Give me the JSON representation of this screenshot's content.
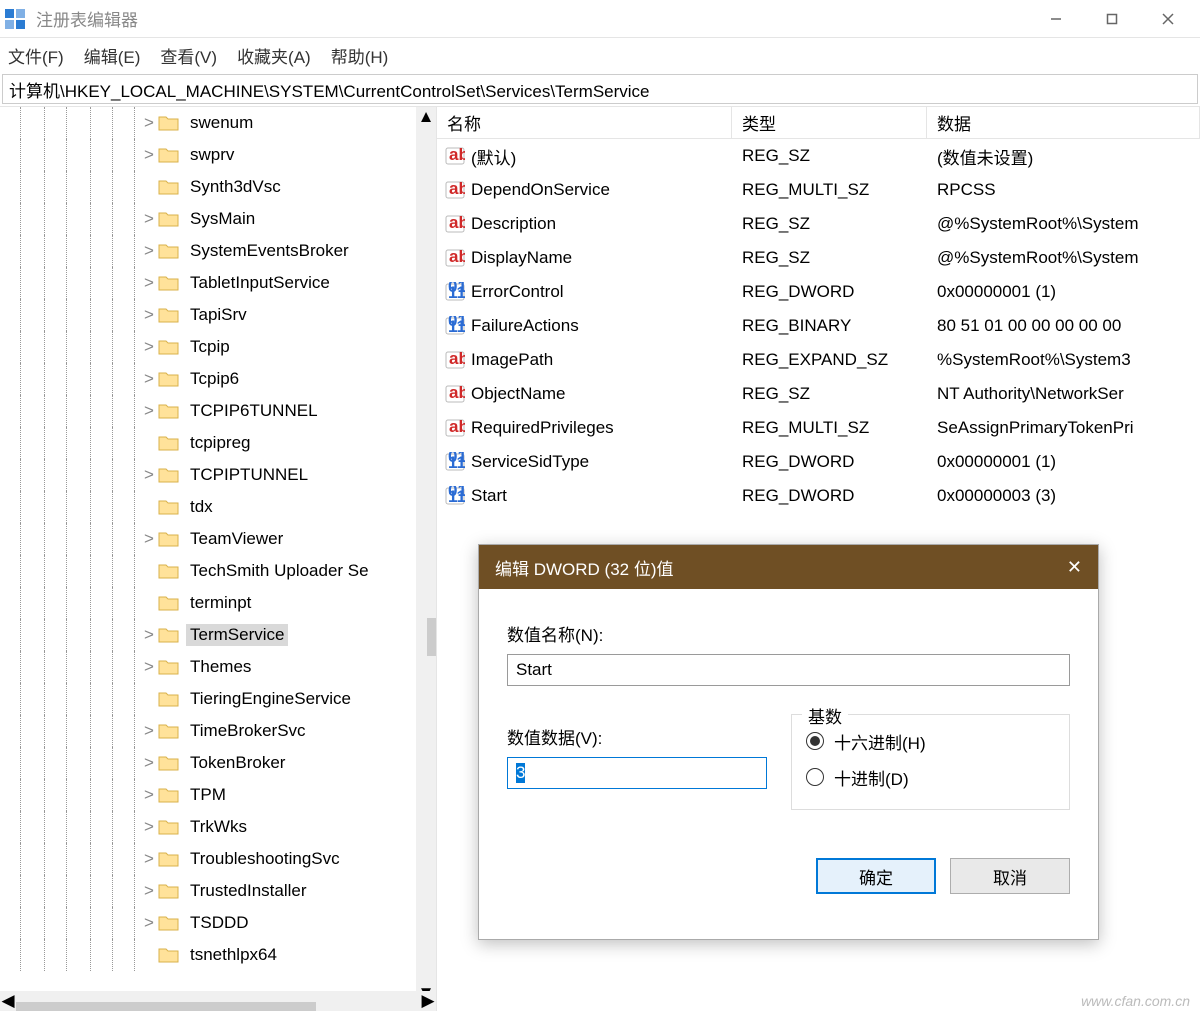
{
  "window": {
    "title": "注册表编辑器"
  },
  "menubar": {
    "file": "文件(F)",
    "edit": "编辑(E)",
    "view": "查看(V)",
    "favorites": "收藏夹(A)",
    "help": "帮助(H)"
  },
  "address": "计算机\\HKEY_LOCAL_MACHINE\\SYSTEM\\CurrentControlSet\\Services\\TermService",
  "tree": [
    {
      "label": "swenum",
      "expand": ">"
    },
    {
      "label": "swprv",
      "expand": ">"
    },
    {
      "label": "Synth3dVsc",
      "expand": ""
    },
    {
      "label": "SysMain",
      "expand": ">"
    },
    {
      "label": "SystemEventsBroker",
      "expand": ">"
    },
    {
      "label": "TabletInputService",
      "expand": ">"
    },
    {
      "label": "TapiSrv",
      "expand": ">"
    },
    {
      "label": "Tcpip",
      "expand": ">"
    },
    {
      "label": "Tcpip6",
      "expand": ">"
    },
    {
      "label": "TCPIP6TUNNEL",
      "expand": ">"
    },
    {
      "label": "tcpipreg",
      "expand": ""
    },
    {
      "label": "TCPIPTUNNEL",
      "expand": ">"
    },
    {
      "label": "tdx",
      "expand": ""
    },
    {
      "label": "TeamViewer",
      "expand": ">"
    },
    {
      "label": "TechSmith Uploader Se",
      "expand": ""
    },
    {
      "label": "terminpt",
      "expand": ""
    },
    {
      "label": "TermService",
      "expand": ">",
      "selected": true
    },
    {
      "label": "Themes",
      "expand": ">"
    },
    {
      "label": "TieringEngineService",
      "expand": ""
    },
    {
      "label": "TimeBrokerSvc",
      "expand": ">"
    },
    {
      "label": "TokenBroker",
      "expand": ">"
    },
    {
      "label": "TPM",
      "expand": ">"
    },
    {
      "label": "TrkWks",
      "expand": ">"
    },
    {
      "label": "TroubleshootingSvc",
      "expand": ">"
    },
    {
      "label": "TrustedInstaller",
      "expand": ">"
    },
    {
      "label": "TSDDD",
      "expand": ">"
    },
    {
      "label": "tsnethlpx64",
      "expand": ""
    }
  ],
  "list": {
    "headers": {
      "name": "名称",
      "type": "类型",
      "data": "数据"
    },
    "rows": [
      {
        "icon": "ab",
        "name": "(默认)",
        "type": "REG_SZ",
        "data": "(数值未设置)"
      },
      {
        "icon": "ab",
        "name": "DependOnService",
        "type": "REG_MULTI_SZ",
        "data": "RPCSS"
      },
      {
        "icon": "ab",
        "name": "Description",
        "type": "REG_SZ",
        "data": "@%SystemRoot%\\System"
      },
      {
        "icon": "ab",
        "name": "DisplayName",
        "type": "REG_SZ",
        "data": "@%SystemRoot%\\System"
      },
      {
        "icon": "bin",
        "name": "ErrorControl",
        "type": "REG_DWORD",
        "data": "0x00000001 (1)"
      },
      {
        "icon": "bin",
        "name": "FailureActions",
        "type": "REG_BINARY",
        "data": "80 51 01 00 00 00 00 00 "
      },
      {
        "icon": "ab",
        "name": "ImagePath",
        "type": "REG_EXPAND_SZ",
        "data": "%SystemRoot%\\System3"
      },
      {
        "icon": "ab",
        "name": "ObjectName",
        "type": "REG_SZ",
        "data": "NT Authority\\NetworkSer"
      },
      {
        "icon": "ab",
        "name": "RequiredPrivileges",
        "type": "REG_MULTI_SZ",
        "data": "SeAssignPrimaryTokenPri"
      },
      {
        "icon": "bin",
        "name": "ServiceSidType",
        "type": "REG_DWORD",
        "data": "0x00000001 (1)"
      },
      {
        "icon": "bin",
        "name": "Start",
        "type": "REG_DWORD",
        "data": "0x00000003 (3)"
      }
    ]
  },
  "dialog": {
    "title": "编辑 DWORD (32 位)值",
    "name_label": "数值名称(N):",
    "name_value": "Start",
    "data_label": "数值数据(V):",
    "data_value": "3",
    "base_label": "基数",
    "hex": "十六进制(H)",
    "dec": "十进制(D)",
    "ok": "确定",
    "cancel": "取消"
  },
  "watermark": "www.cfan.com.cn"
}
